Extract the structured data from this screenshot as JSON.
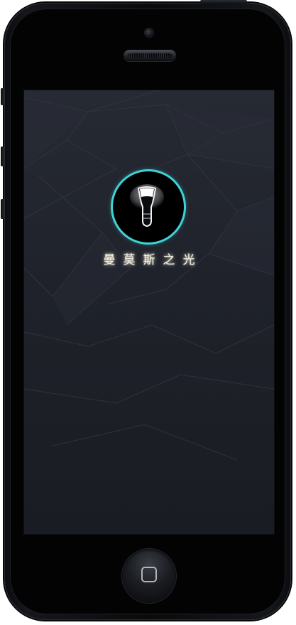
{
  "app": {
    "brand_title": "曼莫斯之光"
  },
  "icons": {
    "logo": "lightbulb-icon",
    "home": "home-button-square-icon"
  },
  "colors": {
    "accent_ring": "#3fd3d8",
    "screen_background": "#1f222a",
    "title_glow": "#f2f2e6"
  }
}
